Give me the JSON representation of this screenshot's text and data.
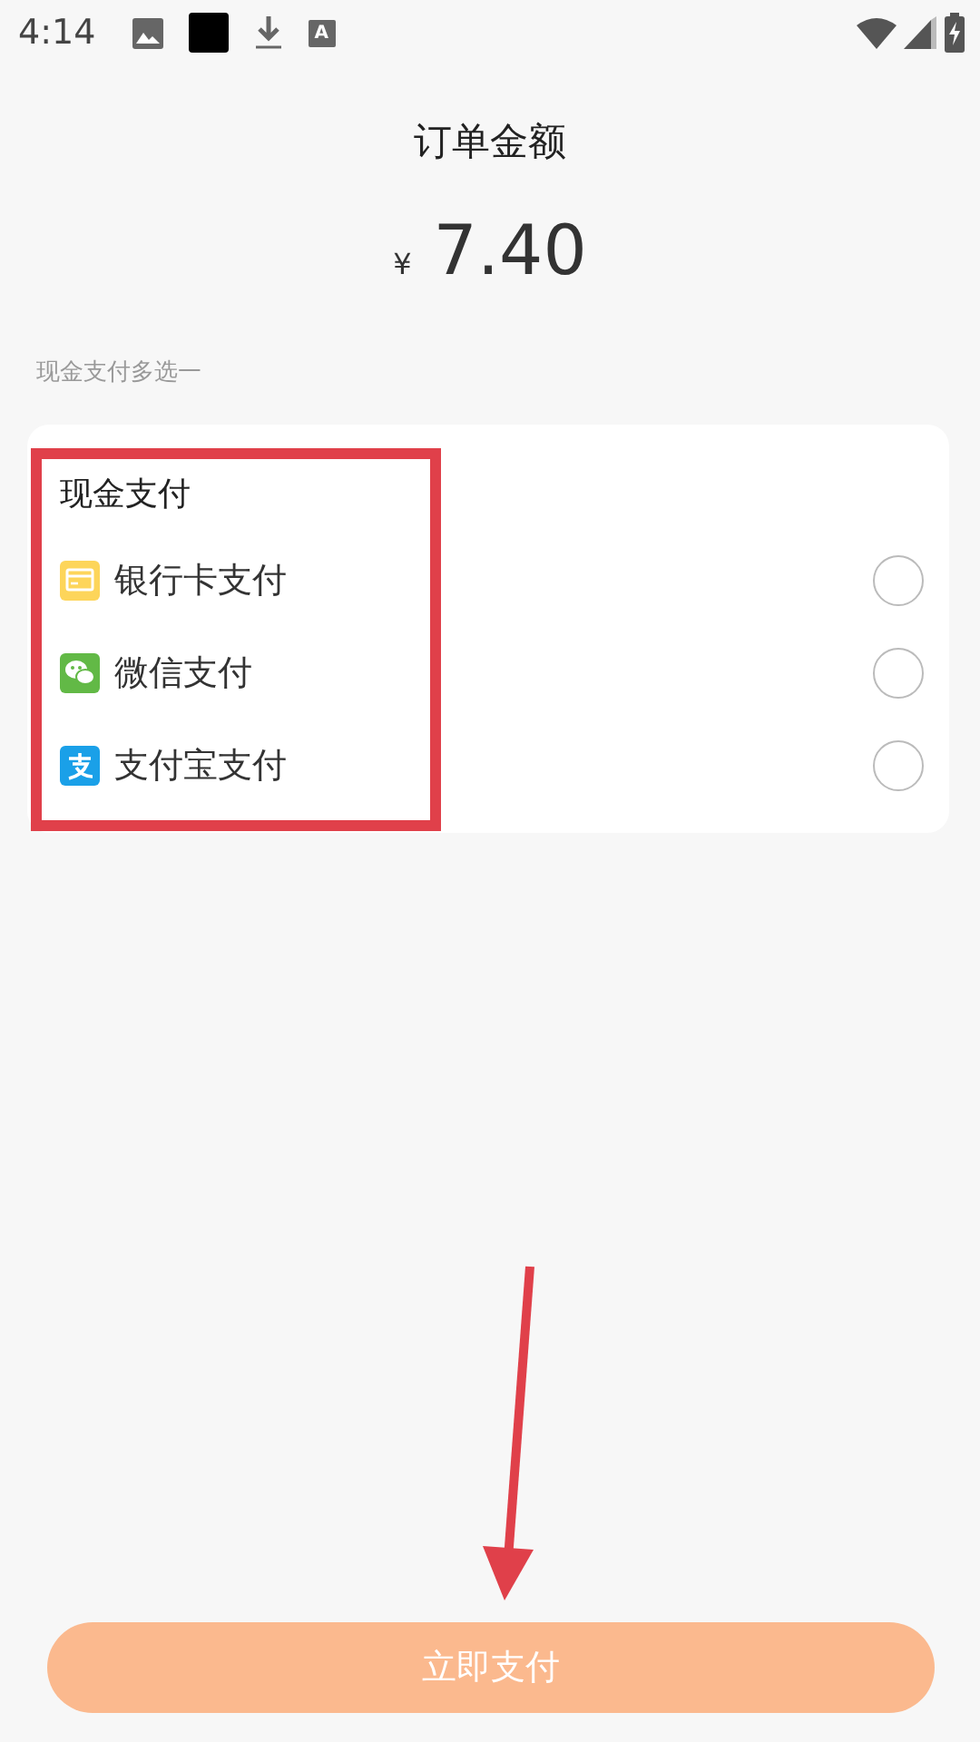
{
  "status_bar": {
    "time": "4:14",
    "badge": "A"
  },
  "order": {
    "title": "订单金额",
    "currency": "¥",
    "amount": "7.40"
  },
  "hint": "现金支付多选一",
  "payment_card": {
    "title": "现金支付",
    "options": [
      {
        "label": "银行卡支付",
        "kind": "card",
        "selected": false
      },
      {
        "label": "微信支付",
        "kind": "wechat",
        "selected": false
      },
      {
        "label": "支付宝支付",
        "kind": "alipay",
        "selected": false
      }
    ]
  },
  "pay_button": "立即支付"
}
